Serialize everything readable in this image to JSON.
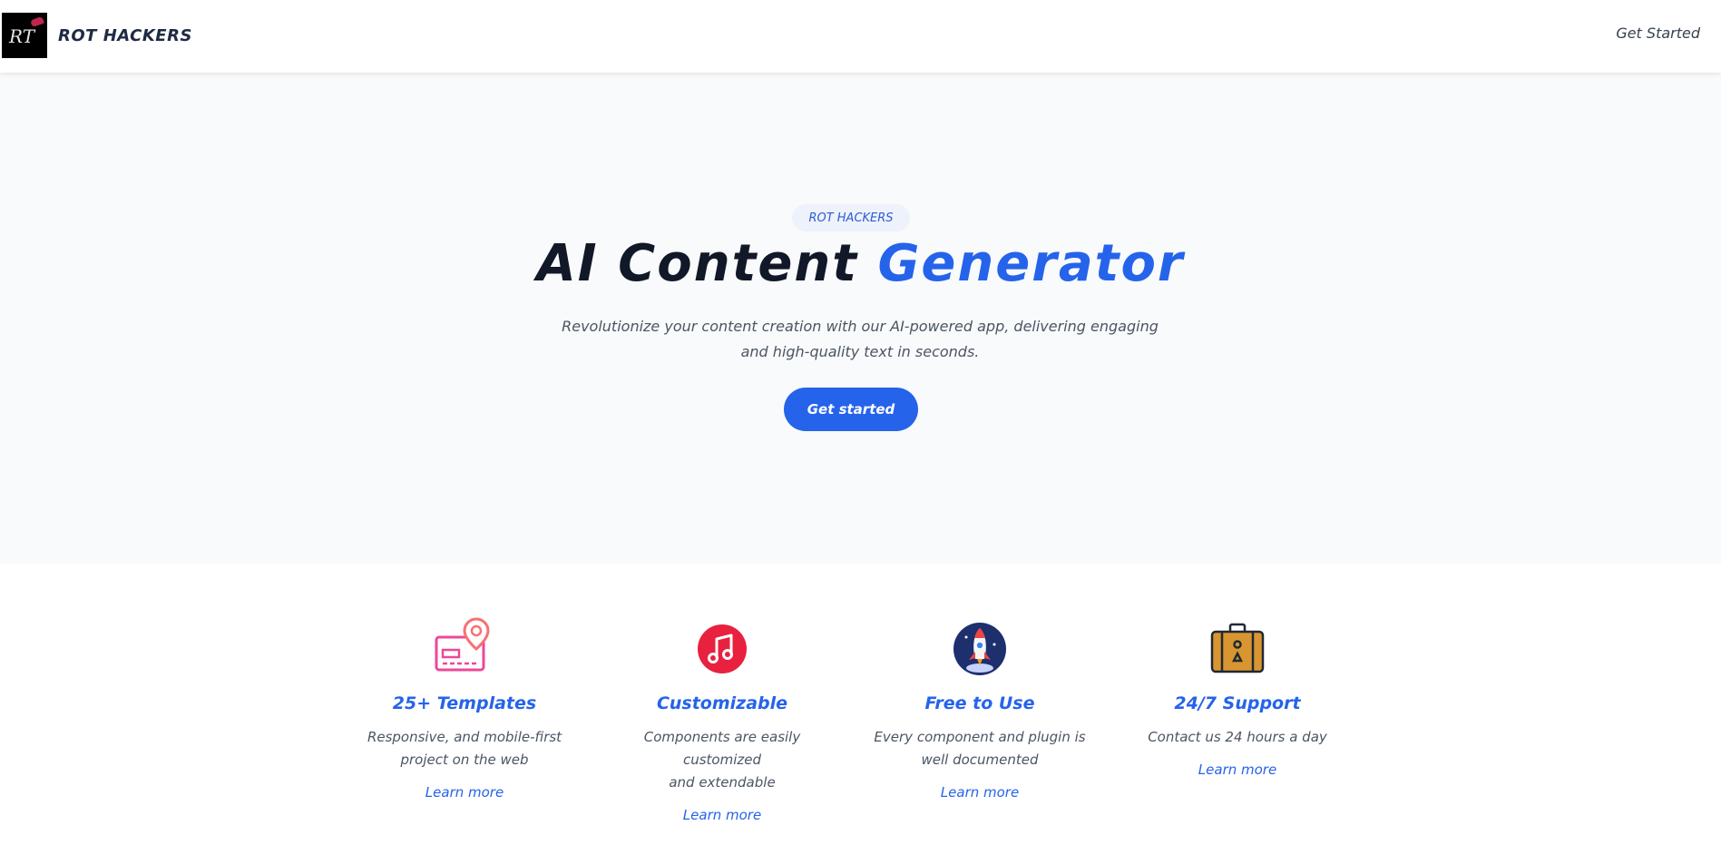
{
  "brand": {
    "name": "ROT HACKERS",
    "logo_text": "RT"
  },
  "nav": {
    "cta": "Get Started"
  },
  "hero": {
    "badge": "ROT HACKERS",
    "title_main": "AI Content ",
    "title_accent": "Generator",
    "subtitle_line1": "Revolutionize your content creation with our AI-powered app, delivering engaging",
    "subtitle_line2": "and high-quality text in seconds.",
    "button": "Get started"
  },
  "features": [
    {
      "icon": "location-card-icon",
      "title": "25+ Templates",
      "desc_line1": "Responsive, and mobile-first",
      "desc_line2": "project on the web",
      "link": "Learn more"
    },
    {
      "icon": "music-note-icon",
      "title": "Customizable",
      "desc_line1": "Components are easily customized",
      "desc_line2": "and extendable",
      "link": "Learn more"
    },
    {
      "icon": "rocket-icon",
      "title": "Free to Use",
      "desc_line1": "Every component and plugin is",
      "desc_line2": "well documented",
      "link": "Learn more"
    },
    {
      "icon": "suitcase-icon",
      "title": "24/7 Support",
      "desc_line1": "Contact us 24 hours a day",
      "desc_line2": "",
      "link": "Learn more"
    }
  ],
  "colors": {
    "accent": "#2563eb",
    "hero_bg": "#f9fafb",
    "badge_bg": "#eef2fb",
    "heading": "#111827"
  }
}
